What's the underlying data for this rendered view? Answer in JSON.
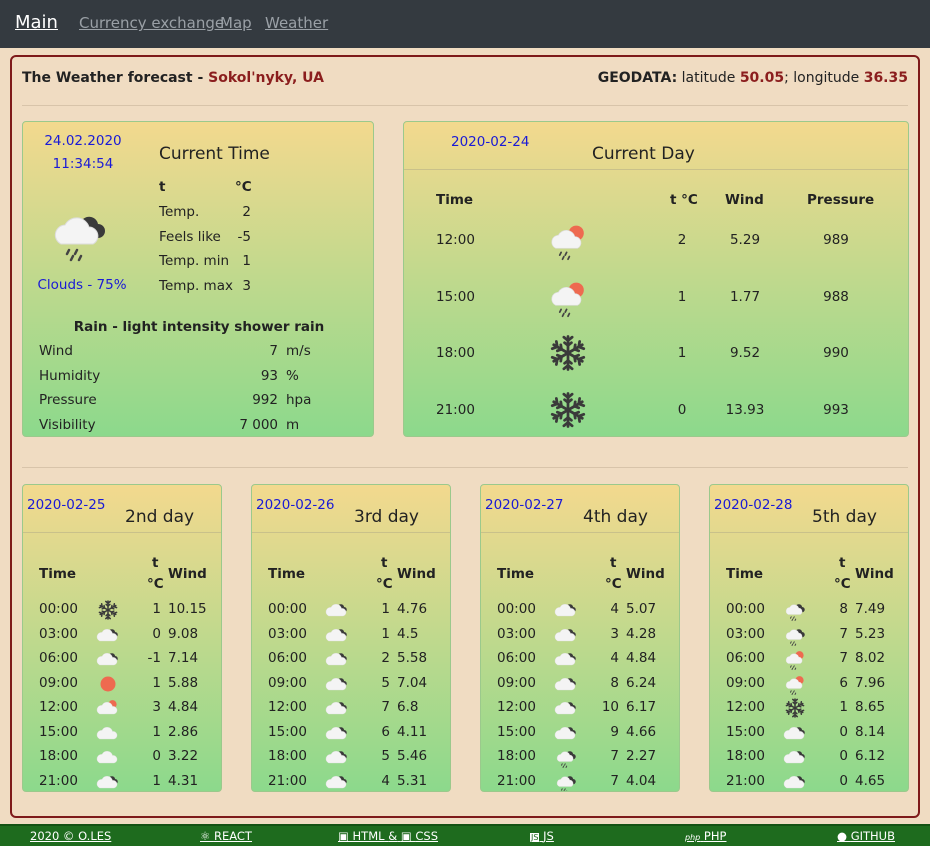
{
  "nav": {
    "main": "Main",
    "currency": "Currency exchange",
    "map": "Map",
    "weather": "Weather"
  },
  "header": {
    "title": "The Weather forecast",
    "dash": "-",
    "city": "Sokol'nyky, UA",
    "geo_label": "GEODATA:",
    "lat_label": "latitude",
    "lat": "50.05",
    "sep": ";",
    "lon_label": "longitude",
    "lon": "36.35"
  },
  "current": {
    "date": "24.02.2020",
    "time": "11:34:54",
    "title": "Current Time",
    "clouds": "Clouds - 75%",
    "col_t": "t",
    "col_c": "°C",
    "rows": [
      {
        "l": "Temp.",
        "v": "2"
      },
      {
        "l": "Feels like",
        "v": "-5"
      },
      {
        "l": "Temp. min",
        "v": "1"
      },
      {
        "l": "Temp. max",
        "v": "3"
      }
    ],
    "desc": "Rain - light intensity shower rain",
    "details": [
      {
        "l": "Wind",
        "v": "7",
        "u": "m/s"
      },
      {
        "l": "Humidity",
        "v": "93",
        "u": "%"
      },
      {
        "l": "Pressure",
        "v": "992",
        "u": "hpa"
      },
      {
        "l": "Visibility",
        "v": "7 000",
        "u": "m"
      }
    ],
    "icon": "rain-cloud-icon"
  },
  "today": {
    "date": "2020-02-24",
    "title": "Current Day",
    "heads": {
      "time": "Time",
      "t": "t °C",
      "wind": "Wind",
      "pressure": "Pressure"
    },
    "rows": [
      {
        "time": "12:00",
        "icon": "sun-rain-icon",
        "t": "2",
        "wind": "5.29",
        "p": "989"
      },
      {
        "time": "15:00",
        "icon": "sun-rain-icon",
        "t": "1",
        "wind": "1.77",
        "p": "988"
      },
      {
        "time": "18:00",
        "icon": "snowflake-icon",
        "t": "1",
        "wind": "9.52",
        "p": "990"
      },
      {
        "time": "21:00",
        "icon": "snowflake-icon",
        "t": "0",
        "wind": "13.93",
        "p": "993"
      }
    ]
  },
  "days_heads": {
    "time": "Time",
    "t1": "t",
    "t2": "°C",
    "wind": "Wind"
  },
  "days": [
    {
      "date": "2020-02-25",
      "title": "2nd day",
      "rows": [
        {
          "time": "00:00",
          "icon": "snowflake-icon",
          "t": "1",
          "w": "10.15"
        },
        {
          "time": "03:00",
          "icon": "clouds-icon",
          "t": "0",
          "w": "9.08"
        },
        {
          "time": "06:00",
          "icon": "clouds-icon",
          "t": "-1",
          "w": "7.14"
        },
        {
          "time": "09:00",
          "icon": "sun-icon",
          "t": "1",
          "w": "5.88"
        },
        {
          "time": "12:00",
          "icon": "sun-cloud-icon",
          "t": "3",
          "w": "4.84"
        },
        {
          "time": "15:00",
          "icon": "cloud-icon",
          "t": "1",
          "w": "2.86"
        },
        {
          "time": "18:00",
          "icon": "cloud-icon",
          "t": "0",
          "w": "3.22"
        },
        {
          "time": "21:00",
          "icon": "clouds-icon",
          "t": "1",
          "w": "4.31"
        }
      ]
    },
    {
      "date": "2020-02-26",
      "title": "3rd day",
      "rows": [
        {
          "time": "00:00",
          "icon": "clouds-icon",
          "t": "1",
          "w": "4.76"
        },
        {
          "time": "03:00",
          "icon": "clouds-icon",
          "t": "1",
          "w": "4.5"
        },
        {
          "time": "06:00",
          "icon": "clouds-icon",
          "t": "2",
          "w": "5.58"
        },
        {
          "time": "09:00",
          "icon": "clouds-icon",
          "t": "5",
          "w": "7.04"
        },
        {
          "time": "12:00",
          "icon": "clouds-icon",
          "t": "7",
          "w": "6.8"
        },
        {
          "time": "15:00",
          "icon": "clouds-icon",
          "t": "6",
          "w": "4.11"
        },
        {
          "time": "18:00",
          "icon": "clouds-icon",
          "t": "5",
          "w": "5.46"
        },
        {
          "time": "21:00",
          "icon": "clouds-icon",
          "t": "4",
          "w": "5.31"
        }
      ]
    },
    {
      "date": "2020-02-27",
      "title": "4th day",
      "rows": [
        {
          "time": "00:00",
          "icon": "clouds-icon",
          "t": "4",
          "w": "5.07"
        },
        {
          "time": "03:00",
          "icon": "clouds-icon",
          "t": "3",
          "w": "4.28"
        },
        {
          "time": "06:00",
          "icon": "clouds-icon",
          "t": "4",
          "w": "4.84"
        },
        {
          "time": "09:00",
          "icon": "clouds-icon",
          "t": "8",
          "w": "6.24"
        },
        {
          "time": "12:00",
          "icon": "clouds-icon",
          "t": "10",
          "w": "6.17"
        },
        {
          "time": "15:00",
          "icon": "clouds-icon",
          "t": "9",
          "w": "4.66"
        },
        {
          "time": "18:00",
          "icon": "rain-cloud-icon",
          "t": "7",
          "w": "2.27"
        },
        {
          "time": "21:00",
          "icon": "rain-cloud-icon",
          "t": "7",
          "w": "4.04"
        }
      ]
    },
    {
      "date": "2020-02-28",
      "title": "5th day",
      "rows": [
        {
          "time": "00:00",
          "icon": "rain-cloud-icon",
          "t": "8",
          "w": "7.49"
        },
        {
          "time": "03:00",
          "icon": "rain-cloud-icon",
          "t": "7",
          "w": "5.23"
        },
        {
          "time": "06:00",
          "icon": "sun-rain-icon",
          "t": "7",
          "w": "8.02"
        },
        {
          "time": "09:00",
          "icon": "sun-rain-icon",
          "t": "6",
          "w": "7.96"
        },
        {
          "time": "12:00",
          "icon": "snowflake-icon",
          "t": "1",
          "w": "8.65"
        },
        {
          "time": "15:00",
          "icon": "clouds-icon",
          "t": "0",
          "w": "8.14"
        },
        {
          "time": "18:00",
          "icon": "clouds-icon",
          "t": "0",
          "w": "6.12"
        },
        {
          "time": "21:00",
          "icon": "clouds-icon",
          "t": "0",
          "w": "4.65"
        }
      ]
    }
  ],
  "footer": {
    "copy": "2020 © O.LES",
    "react": "REACT",
    "html": "HTML",
    "amp": "&",
    "css": "CSS",
    "js": "JS",
    "php": "PHP",
    "github": "GITHUB"
  },
  "colors": {
    "accent": "#8b1e1e",
    "link": "#1a1ad6",
    "nav": "#343a40",
    "footer": "#1e6b1e"
  }
}
